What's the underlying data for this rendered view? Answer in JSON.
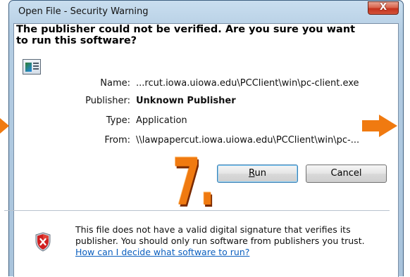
{
  "window": {
    "title": "Open File - Security Warning",
    "close_label": "X"
  },
  "headline": "The publisher could not be verified.  Are you sure you want to run this software?",
  "details": [
    {
      "label": "Name:",
      "value": "...rcut.iowa.uiowa.edu\\PCClient\\win\\pc-client.exe"
    },
    {
      "label": "Publisher:",
      "value": "Unknown Publisher"
    },
    {
      "label": "Type:",
      "value": "Application"
    },
    {
      "label": "From:",
      "value": "\\\\lawpapercut.iowa.uiowa.edu\\PCClient\\win\\pc-..."
    }
  ],
  "buttons": {
    "run_mnemonic": "R",
    "run_rest": "un",
    "cancel": "Cancel"
  },
  "footer": {
    "warning_text": "This file does not have a valid digital signature that verifies its publisher.  You should only run software from publishers you trust.",
    "help_link": "How can I decide what software to run?"
  },
  "icons": {
    "app": "application-icon",
    "shield": "security-shield-error-icon"
  },
  "annotation": {
    "step_label": "7.",
    "accent_color": "#f07a10"
  }
}
